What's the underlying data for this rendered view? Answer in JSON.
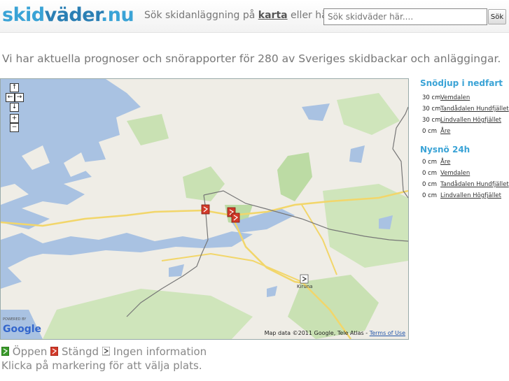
{
  "header": {
    "logo_part1": "skid",
    "logo_part2": "väder",
    "logo_part3": ".nu",
    "search_label_before": "Sök skidanläggning på",
    "search_label_link": "karta",
    "search_label_after": "eller här:",
    "search_placeholder": "Sök skidväder här....",
    "search_button": "Sök"
  },
  "intro": "Vi har aktuella prognoser och snörapporter för 280 av Sveriges skidbackar och anläggingar.",
  "map": {
    "controls": [
      "↑",
      "←",
      "→",
      "↓",
      "+",
      "−"
    ],
    "city_label": "Kiruna",
    "attribution": "Map data ©2011 Google, Tele Atlas -",
    "terms_link": "Terms of Use",
    "powered_by": "POWERED BY",
    "google_logo": "Google"
  },
  "snow_depth": {
    "title": "Snödjup i nedfart",
    "items": [
      {
        "value": "30 cm",
        "name": "Vemdalen"
      },
      {
        "value": "30 cm",
        "name": "Tandådalen Hundfjället"
      },
      {
        "value": "30 cm",
        "name": "Lindvallen Högfjället"
      },
      {
        "value": "0 cm",
        "name": "Åre"
      }
    ]
  },
  "new_snow": {
    "title": "Nysnö 24h",
    "items": [
      {
        "value": "0 cm",
        "name": "Åre"
      },
      {
        "value": "0 cm",
        "name": "Vemdalen"
      },
      {
        "value": "0 cm",
        "name": "Tandådalen Hundfjället"
      },
      {
        "value": "0 cm",
        "name": "Lindvallen Högfjället"
      }
    ]
  },
  "legend": {
    "open": "Öppen",
    "closed": "Stängd",
    "no_info": "Ingen information",
    "hint": "Klicka på markering för att välja plats."
  },
  "colors": {
    "accent": "#3aa3d6",
    "open": "#3a9a2a",
    "closed": "#d23a2a"
  }
}
